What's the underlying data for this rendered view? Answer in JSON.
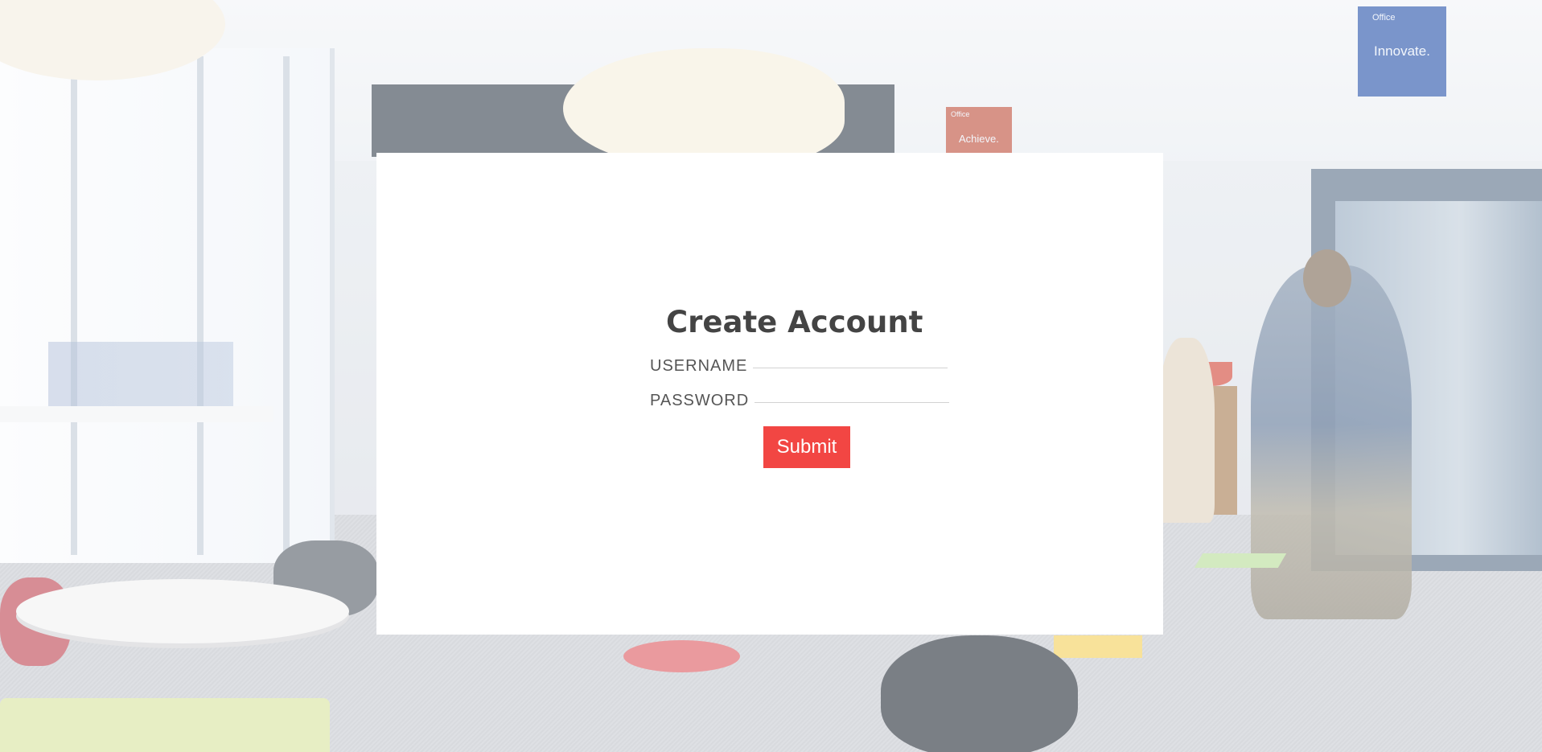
{
  "background": {
    "banner_blue_brand": "Office",
    "banner_blue_text": "Innovate.",
    "banner_red_brand": "Office",
    "banner_red_text": "Achieve."
  },
  "form": {
    "title": "Create Account",
    "username_label": "USERNAME",
    "username_value": "",
    "password_label": "PASSWORD",
    "password_value": "",
    "submit_label": "Submit"
  },
  "colors": {
    "card_background": "#ffffff",
    "title_text": "#444444",
    "label_text": "#555555",
    "submit_background": "#f24643",
    "submit_text": "#ffffff",
    "input_underline": "#d2d2d2"
  }
}
